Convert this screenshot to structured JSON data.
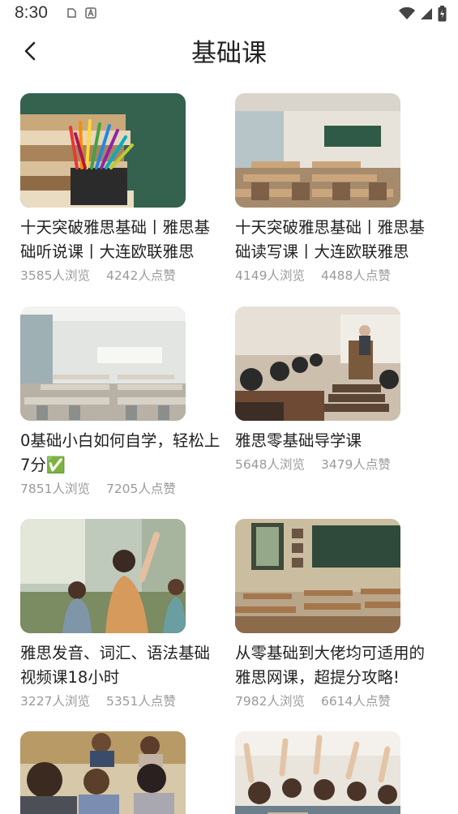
{
  "status_bar": {
    "time": "8:30"
  },
  "header": {
    "title": "基础课"
  },
  "courses": [
    {
      "title": "十天突破雅思基础丨雅思基础听说课丨大连欧联雅思",
      "views": "3585人浏览",
      "likes": "4242人点赞",
      "image": "pencils-chalkboard"
    },
    {
      "title": "十天突破雅思基础丨雅思基础读写课丨大连欧联雅思",
      "views": "4149人浏览",
      "likes": "4488人点赞",
      "image": "classroom-desks"
    },
    {
      "title": "0基础小白如何自学，轻松上7分✅",
      "views": "7851人浏览",
      "likes": "7205人点赞",
      "image": "empty-classroom"
    },
    {
      "title": "雅思零基础导学课",
      "views": "5648人浏览",
      "likes": "3479人点赞",
      "image": "lecture-hall"
    },
    {
      "title": "雅思发音、词汇、语法基础视频课18小时",
      "views": "3227人浏览",
      "likes": "5351人点赞",
      "image": "students-raising-hands"
    },
    {
      "title": "从零基础到大佬均可适用的雅思网课，超提分攻略!",
      "views": "7982人浏览",
      "likes": "6614人点赞",
      "image": "vintage-classroom"
    },
    {
      "title": "",
      "views": "",
      "likes": "",
      "image": "students-group"
    },
    {
      "title": "",
      "views": "",
      "likes": "",
      "image": "raised-hands-crowd"
    }
  ]
}
